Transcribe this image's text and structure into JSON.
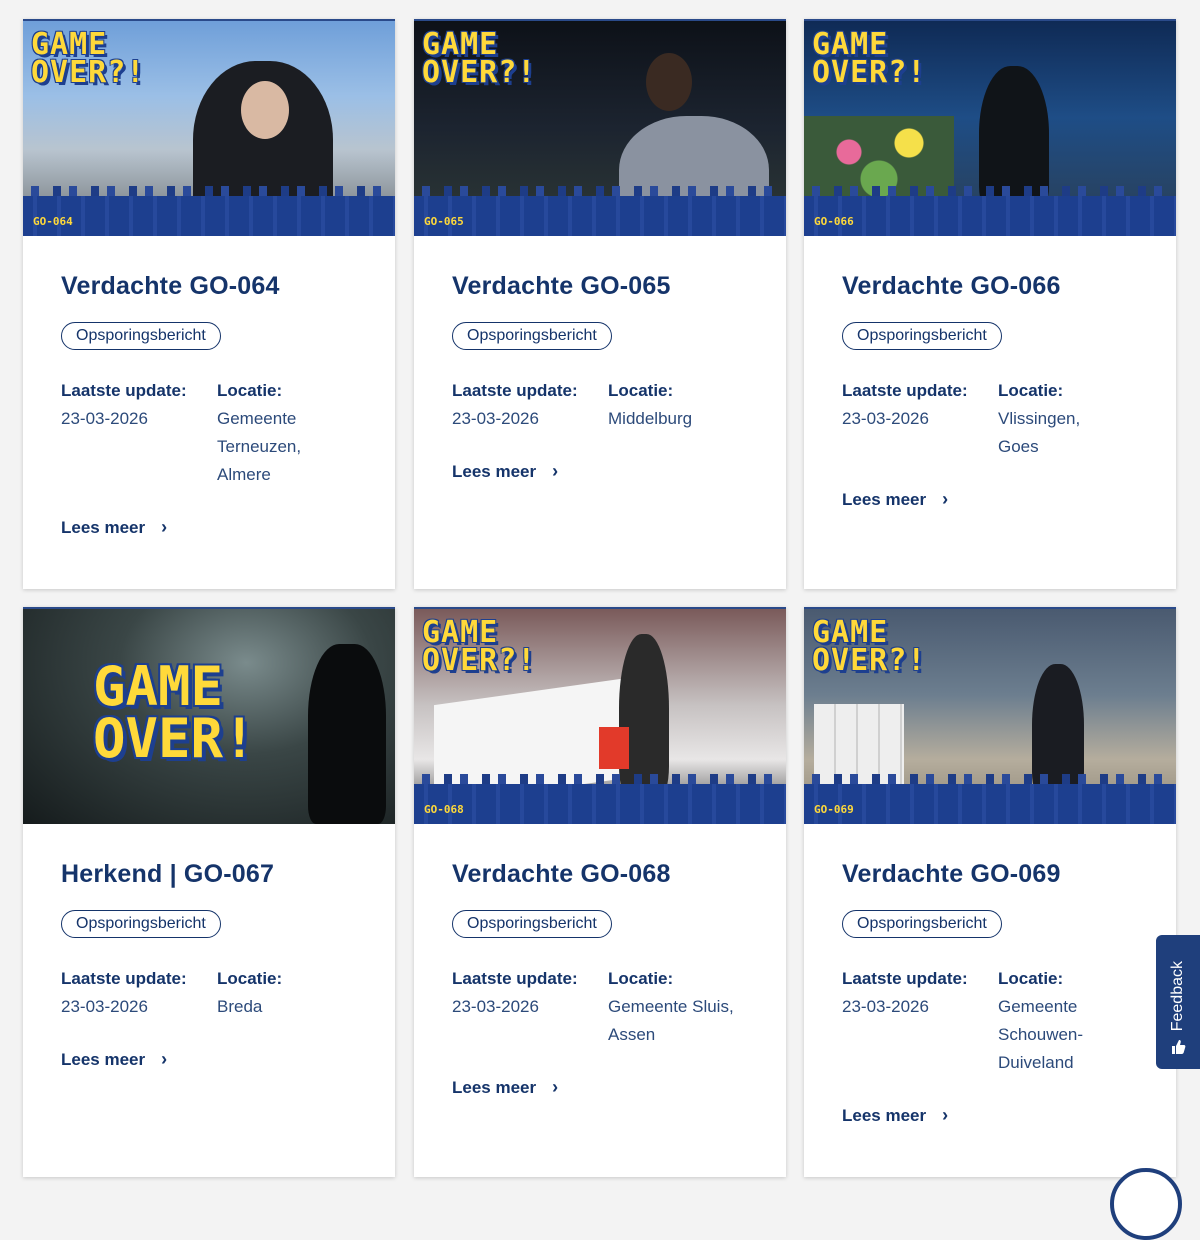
{
  "cards": [
    {
      "code": "GO-064",
      "logo": "GAME OVER?!",
      "title": "Verdachte GO-064",
      "badge": "Opsporingsbericht",
      "update_label": "Laatste update:",
      "update_value": "23-03-2026",
      "location_label": "Locatie:",
      "location_lines": [
        "Gemeente",
        "Terneuzen,",
        "Almere"
      ],
      "read_more": "Lees meer"
    },
    {
      "code": "GO-065",
      "logo": "GAME OVER?!",
      "title": "Verdachte GO-065",
      "badge": "Opsporingsbericht",
      "update_label": "Laatste update:",
      "update_value": "23-03-2026",
      "location_label": "Locatie:",
      "location_lines": [
        "Middelburg"
      ],
      "read_more": "Lees meer"
    },
    {
      "code": "GO-066",
      "logo": "GAME OVER?!",
      "title": "Verdachte GO-066",
      "badge": "Opsporingsbericht",
      "update_label": "Laatste update:",
      "update_value": "23-03-2026",
      "location_label": "Locatie:",
      "location_lines": [
        "Vlissingen,",
        "Goes"
      ],
      "read_more": "Lees meer"
    },
    {
      "code": "",
      "logo": "GAME OVER!",
      "title": "Herkend | GO-067",
      "badge": "Opsporingsbericht",
      "update_label": "Laatste update:",
      "update_value": "23-03-2026",
      "location_label": "Locatie:",
      "location_lines": [
        "Breda"
      ],
      "read_more": "Lees meer"
    },
    {
      "code": "GO-068",
      "logo": "GAME OVER?!",
      "title": "Verdachte GO-068",
      "badge": "Opsporingsbericht",
      "update_label": "Laatste update:",
      "update_value": "23-03-2026",
      "location_label": "Locatie:",
      "location_lines": [
        "Gemeente Sluis,",
        "Assen"
      ],
      "read_more": "Lees meer"
    },
    {
      "code": "GO-069",
      "logo": "GAME OVER?!",
      "title": "Verdachte GO-069",
      "badge": "Opsporingsbericht",
      "update_label": "Laatste update:",
      "update_value": "23-03-2026",
      "location_label": "Locatie:",
      "location_lines": [
        "Gemeente",
        "Schouwen-",
        "Duiveland"
      ],
      "read_more": "Lees meer"
    }
  ],
  "feedback": {
    "label": "Feedback",
    "icon": "thumbs-icon"
  },
  "colors": {
    "primary": "#15346a",
    "accent": "#ffd93a",
    "banner": "#1d3f8f"
  }
}
